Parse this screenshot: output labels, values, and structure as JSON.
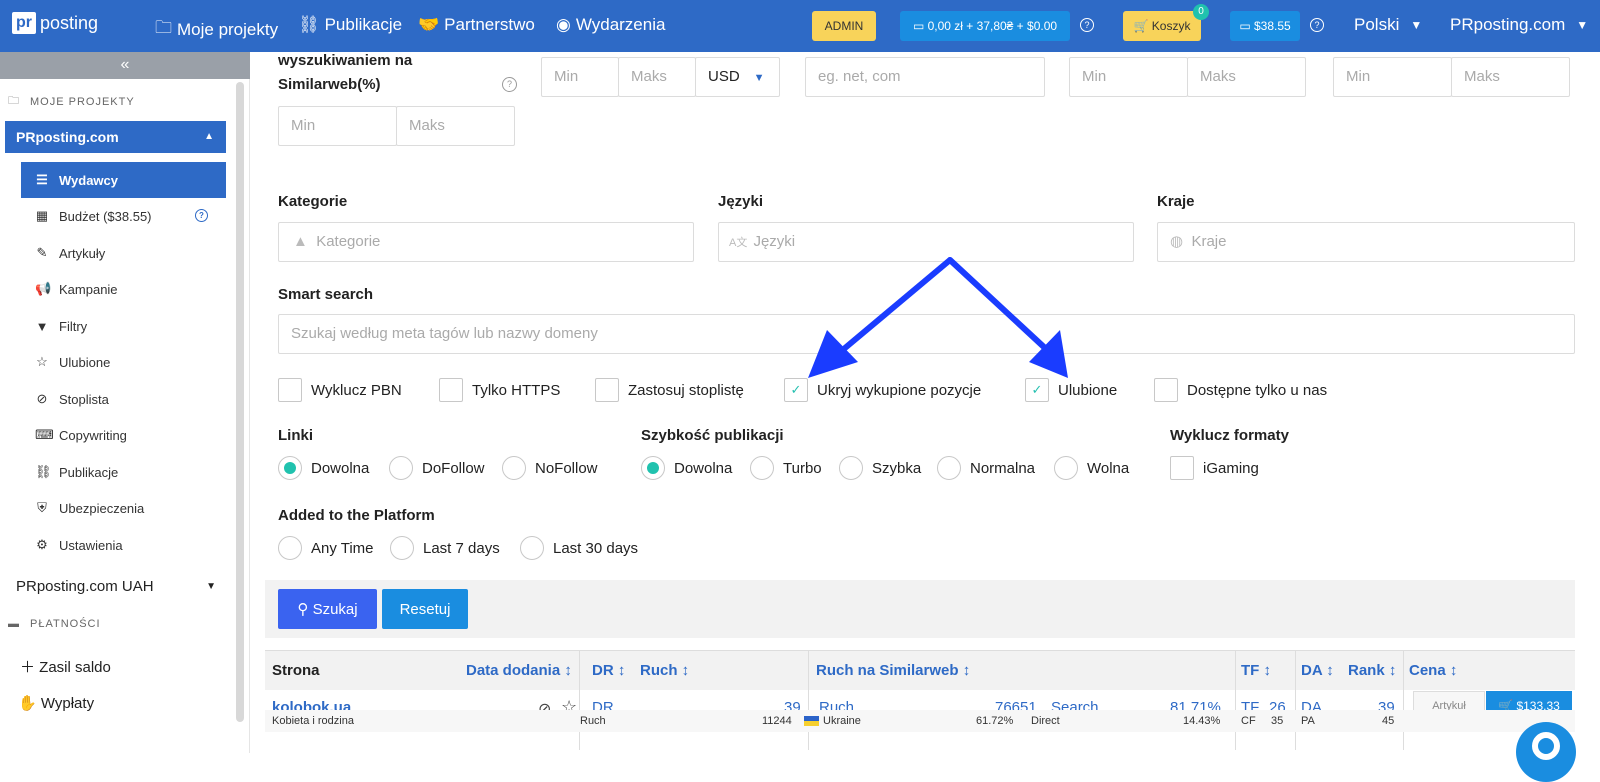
{
  "topbar": {
    "logo_pr": "pr",
    "logo_text": "posting",
    "nav": [
      {
        "icon": "folder-icon",
        "glyph": "🗀",
        "label": "Moje projekty"
      },
      {
        "icon": "sitemap-icon",
        "glyph": "⛓",
        "label": "Publikacje"
      },
      {
        "icon": "handshake-icon",
        "glyph": "🤝",
        "label": "Partnerstwo"
      },
      {
        "icon": "rss-icon",
        "glyph": "◉",
        "label": "Wydarzenia"
      }
    ],
    "admin": "ADMIN",
    "balance": "0,00 zł + 37,80₴ + $0.00",
    "cart": "Koszyk",
    "cart_count": "0",
    "budget": "$38.55",
    "language": "Polski",
    "account": "PRposting.com"
  },
  "sidebar": {
    "collapse": "«",
    "section_projects": "MOJE PROJEKTY",
    "project": "PRposting.com",
    "items": [
      {
        "icon": "list-icon",
        "glyph": "☰",
        "label": "Wydawcy"
      },
      {
        "icon": "calculator-icon",
        "glyph": "▦",
        "label": "Budżet ($38.55)"
      },
      {
        "icon": "pencil-icon",
        "glyph": "✎",
        "label": "Artykuły"
      },
      {
        "icon": "bullhorn-icon",
        "glyph": "📢",
        "label": "Kampanie"
      },
      {
        "icon": "filter-icon",
        "glyph": "▼",
        "label": "Filtry"
      },
      {
        "icon": "star-icon",
        "glyph": "☆",
        "label": "Ulubione"
      },
      {
        "icon": "ban-icon",
        "glyph": "⊘",
        "label": "Stoplista"
      },
      {
        "icon": "keyboard-icon",
        "glyph": "⌨",
        "label": "Copywriting"
      },
      {
        "icon": "sitemap-icon",
        "glyph": "⛓",
        "label": "Publikacje"
      },
      {
        "icon": "shield-icon",
        "glyph": "⛨",
        "label": "Ubezpieczenia"
      },
      {
        "icon": "cogs-icon",
        "glyph": "⚙",
        "label": "Ustawienia"
      }
    ],
    "project2": "PRposting.com UAH",
    "section_payments": "PŁATNOŚCI",
    "topup": "Zasil saldo",
    "withdraw": "Wypłaty"
  },
  "filters": {
    "similar_label_1": "wyszukiwaniem na",
    "similar_label_2": "Similarweb(%)",
    "min": "Min",
    "max": "Maks",
    "currency": "USD",
    "domain_placeholder": "eg. net, com",
    "categories_label": "Kategorie",
    "categories_placeholder": "Kategorie",
    "languages_label": "Języki",
    "languages_placeholder": "Języki",
    "countries_label": "Kraje",
    "countries_placeholder": "Kraje",
    "smart_label": "Smart search",
    "smart_placeholder": "Szukaj według meta tagów lub nazwy domeny",
    "checks": [
      "Wyklucz PBN",
      "Tylko HTTPS",
      "Zastosuj stoplistę",
      "Ukryj wykupione pozycje",
      "Ulubione",
      "Dostępne tylko u nas"
    ],
    "links_label": "Linki",
    "links": [
      "Dowolna",
      "DoFollow",
      "NoFollow"
    ],
    "speed_label": "Szybkość publikacji",
    "speed": [
      "Dowolna",
      "Turbo",
      "Szybka",
      "Normalna",
      "Wolna"
    ],
    "exclude_label": "Wyklucz formaty",
    "exclude": "iGaming",
    "added_label": "Added to the Platform",
    "added": [
      "Any Time",
      "Last 7 days",
      "Last 30 days"
    ],
    "search_btn": "Szukaj",
    "reset_btn": "Resetuj"
  },
  "table": {
    "headers": {
      "site": "Strona",
      "date": "Data dodania ↕",
      "dr": "DR ↕",
      "traffic": "Ruch ↕",
      "similar": "Ruch na Similarweb ↕",
      "tf": "TF ↕",
      "da": "DA ↕",
      "rank": "Rank ↕",
      "price": "Cena ↕"
    },
    "row": {
      "site": "kolobok.ua",
      "dr_label": "DR",
      "dr": "39",
      "traffic_label": "Ruch",
      "traffic": "76651",
      "search_label": "Search",
      "search": "81.71%",
      "tf_label": "TF",
      "tf": "26",
      "da_label": "DA",
      "da": "39",
      "article": "Artykuł",
      "price": "$133.33",
      "category": "Kobieta i rodzina",
      "ruch_label": "Ruch",
      "ruch": "11244",
      "country": "Ukraine",
      "country_pct": "61.72%",
      "direct_label": "Direct",
      "direct": "14.43%",
      "cf_label": "CF",
      "cf": "35",
      "pa_label": "PA",
      "pa": "45"
    }
  }
}
